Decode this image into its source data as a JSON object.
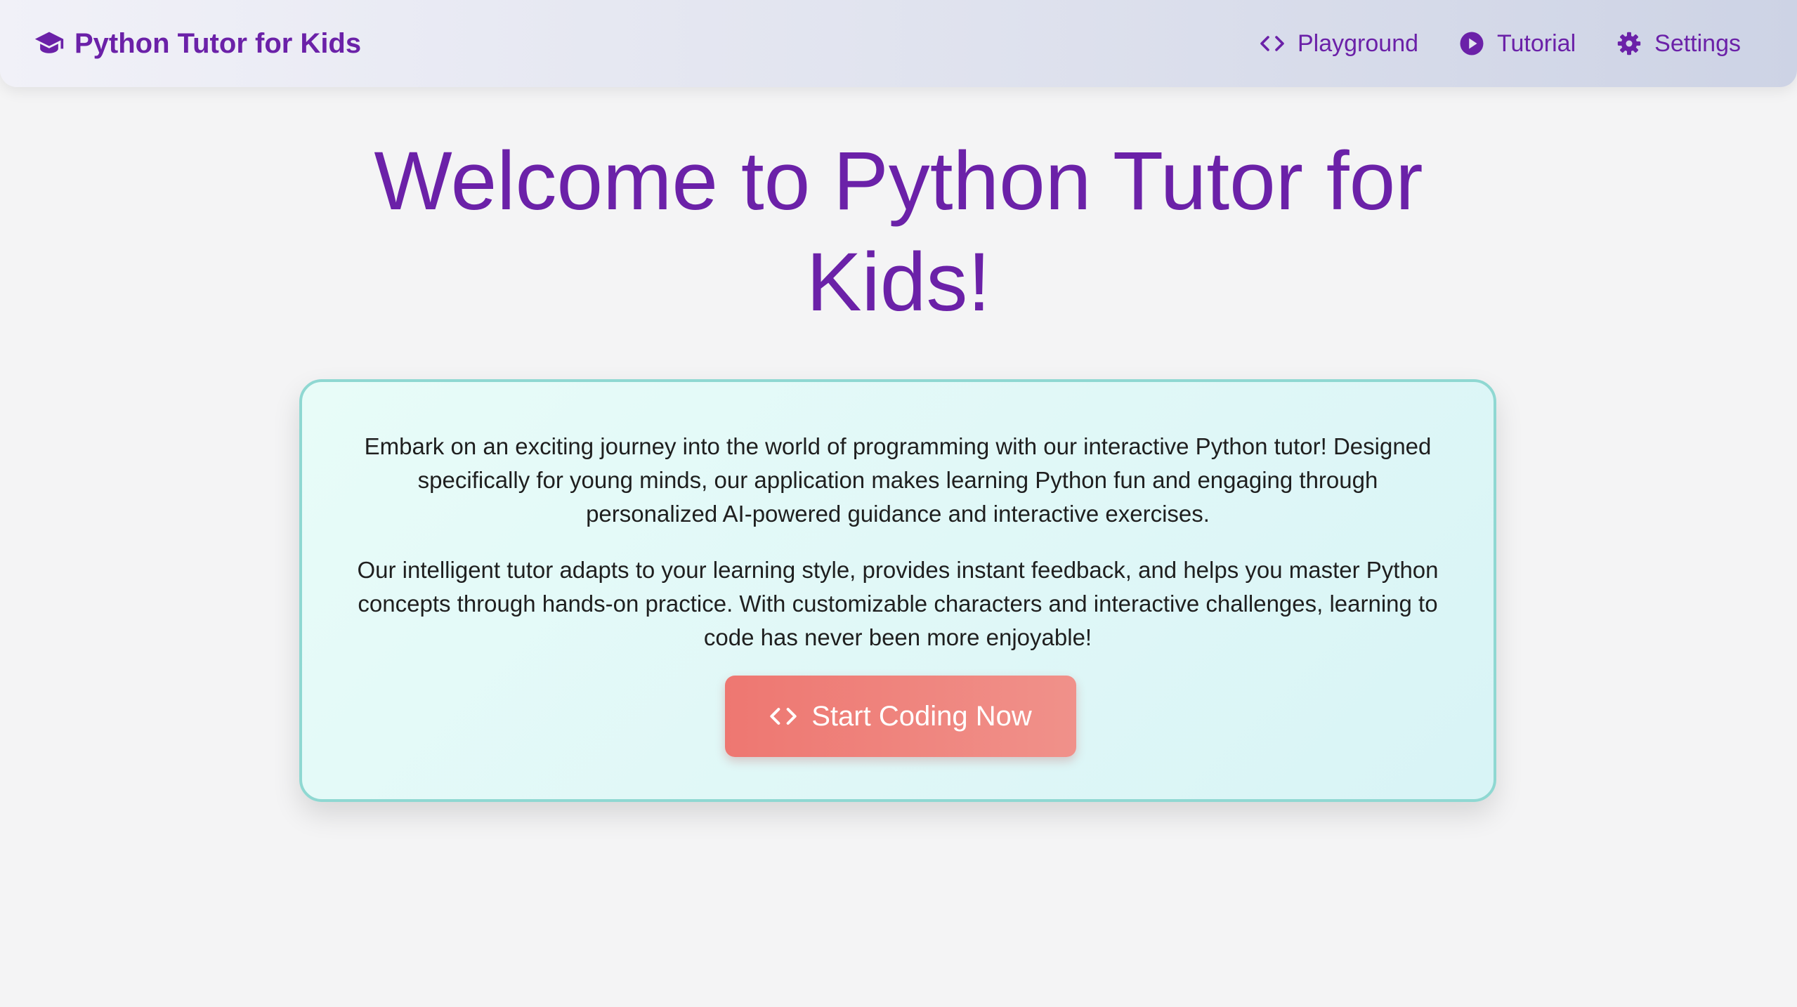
{
  "header": {
    "brand": {
      "label": "Python Tutor for Kids",
      "icon": "graduation-cap-icon"
    },
    "nav": [
      {
        "label": "Playground",
        "icon": "code-icon"
      },
      {
        "label": "Tutorial",
        "icon": "play-circle-icon"
      },
      {
        "label": "Settings",
        "icon": "gear-icon"
      }
    ]
  },
  "hero": {
    "title_line1": "Welcome to Python Tutor for",
    "title_line2": "Kids!"
  },
  "card": {
    "paragraph1": "Embark on an exciting journey into the world of programming with our interactive Python tutor! Designed specifically for young minds, our application makes learning Python fun and engaging through personalized AI-powered guidance and interactive exercises.",
    "paragraph2": "Our intelligent tutor adapts to your learning style, provides instant feedback, and helps you master Python concepts through hands-on practice. With customizable characters and interactive challenges, learning to code has never been more enjoyable!",
    "cta": {
      "label": "Start Coding Now",
      "icon": "code-icon"
    }
  },
  "colors": {
    "brand_purple": "#6b21a8",
    "cta_coral": "#ee7771",
    "card_border": "#8fd8d2",
    "page_background": "#f4f4f5"
  }
}
